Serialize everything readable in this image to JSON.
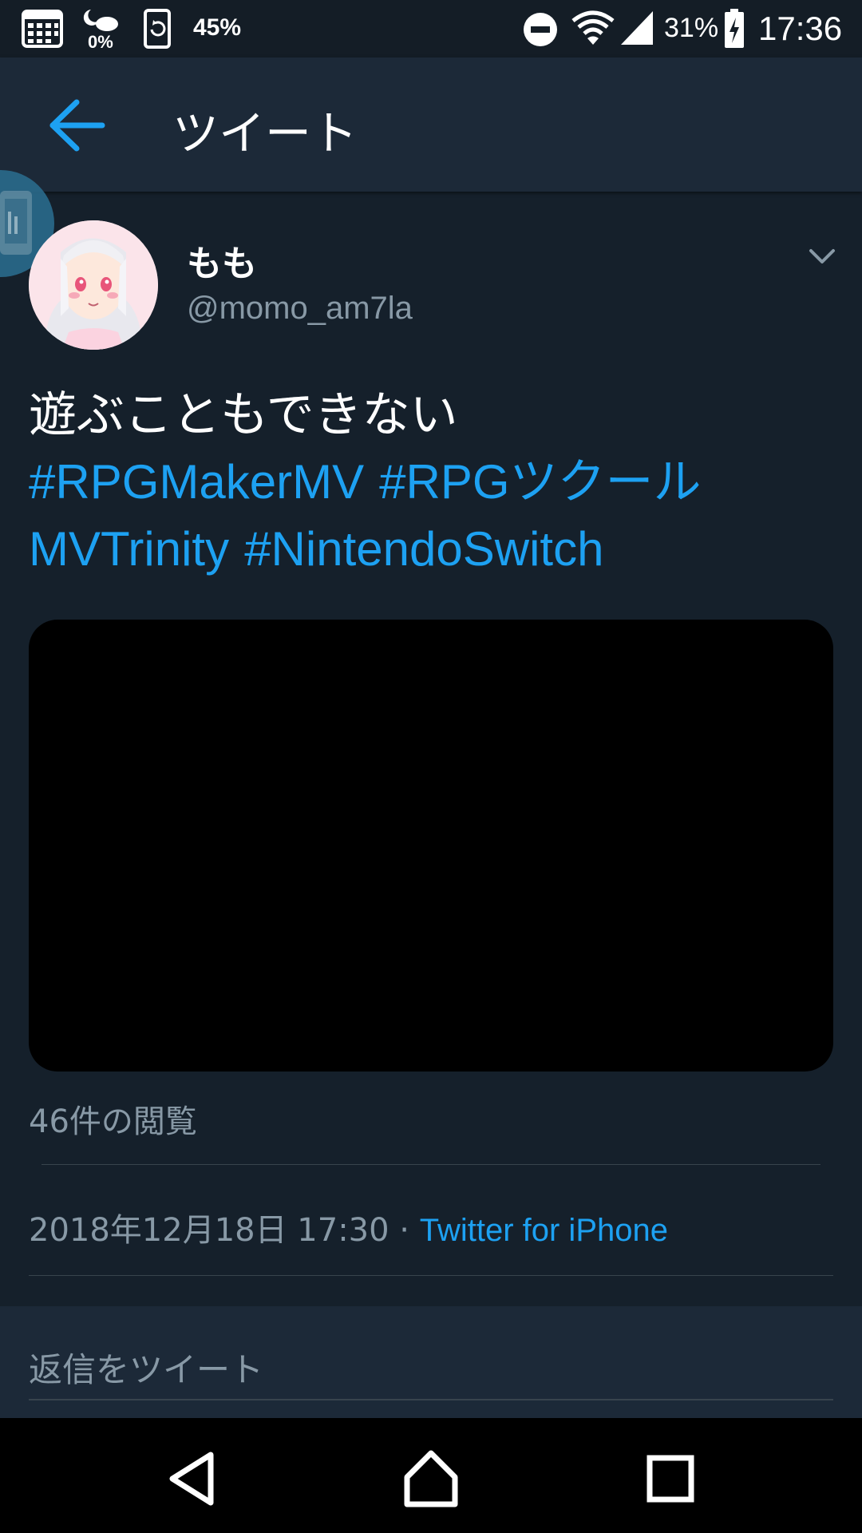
{
  "status_bar": {
    "left_percent": "45%",
    "weather_percent": "0%",
    "battery_percent": "31%",
    "time": "17:36",
    "icons": [
      "calendar-icon",
      "weather-icon",
      "sync-icon",
      "do-not-disturb-icon",
      "wifi-icon",
      "signal-icon",
      "battery-charging-icon"
    ]
  },
  "header": {
    "title": "ツイート",
    "back_icon": "arrow-left-icon"
  },
  "tweet": {
    "author": {
      "display_name": "もも",
      "handle": "@momo_am7la"
    },
    "text": "遊ぶこともできない",
    "hashtags_line1": [
      "#RPGMakerMV",
      "#RPGツクール"
    ],
    "hashtags_line2": [
      "MVTrinity",
      "#NintendoSwitch"
    ],
    "views": "46件の閲覧",
    "timestamp": "2018年12月18日 17:30 · ",
    "source": "Twitter for iPhone"
  },
  "reply": {
    "placeholder": "返信をツイート"
  },
  "colors": {
    "background": "#15202b",
    "header": "#1c2938",
    "accent": "#1da1f2",
    "secondary_text": "#8899a6"
  },
  "navbar": {
    "buttons": [
      "back-triangle-icon",
      "home-icon",
      "recents-square-icon"
    ]
  }
}
